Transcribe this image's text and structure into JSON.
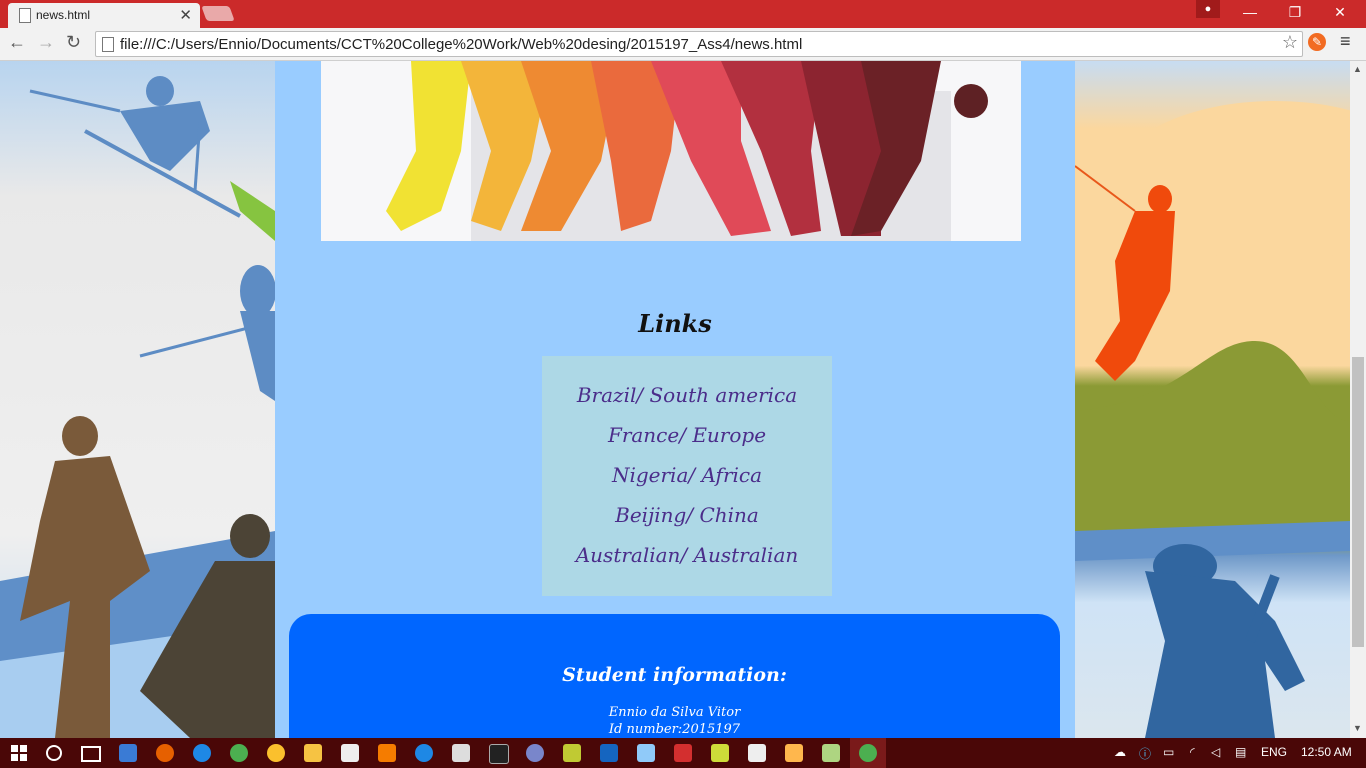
{
  "browser": {
    "tab_title": "news.html",
    "tab_close": "✕",
    "url": "file:///C:/Users/Ennio/Documents/CCT%20College%20Work/Web%20desing/2015197_Ass4/news.html",
    "window_controls": {
      "minimize": "—",
      "restore": "❐",
      "close": "✕"
    },
    "nav": {
      "back": "←",
      "forward": "→",
      "reload": "↻"
    },
    "star": "☆",
    "menu": "≡"
  },
  "page": {
    "links_heading": "Links",
    "links": [
      "Brazil/ South america",
      "France/ Europe",
      "Nigeria/ Africa",
      "Beijing/ China",
      "Australian/ Australian"
    ],
    "footer": {
      "heading": "Student information:",
      "name": "Ennio da Silva Vitor",
      "id": "Id number:2015197"
    }
  },
  "taskbar": {
    "language": "ENG",
    "time": "12:50 AM"
  },
  "colors": {
    "content_bg": "#99ccff",
    "links_box_bg": "#add8e6",
    "link_color": "#4b2d8a",
    "footer_bg": "#0066ff",
    "titlebar_bg": "#cb2a2a"
  }
}
